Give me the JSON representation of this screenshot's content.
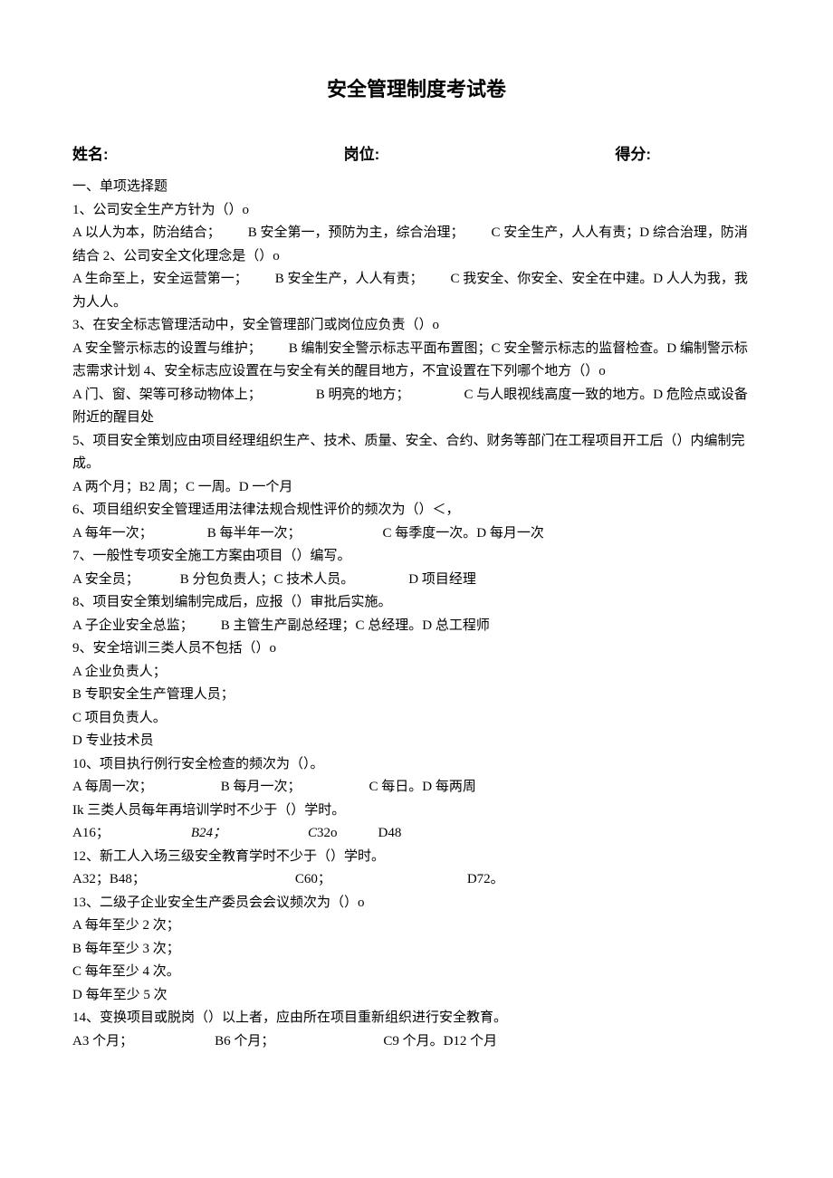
{
  "title": "安全管理制度考试卷",
  "header": {
    "name_label": "姓名:",
    "post_label": "岗位:",
    "score_label": "得分:"
  },
  "section1_heading": "一、单项选择题",
  "lines": {
    "q1": "1、公司安全生产方针为（）o",
    "q1o": "A 以人为本，防治结合；  B 安全第一，预防为主，综合治理；  C 安全生产，人人有责；D 综合治理，防消结合 2、公司安全文化理念是（）o",
    "q2o": "A 生命至上，安全运营第一；  B 安全生产，人人有责；  C 我安全、你安全、安全在中建。D 人人为我，我为人人。",
    "q3": "3、在安全标志管理活动中，安全管理部门或岗位应负责（）o",
    "q3o": "A 安全警示标志的设置与维护；  B 编制安全警示标志平面布置图；C 安全警示标志的监督检查。D 编制警示标志需求计划 4、安全标志应设置在与安全有关的醒目地方，不宜设置在下列哪个地方（）o",
    "q4o": "A 门、窗、架等可移动物体上；    B 明亮的地方；    C 与人眼视线高度一致的地方。D 危险点或设备附近的醒目处",
    "q5": "5、项目安全策划应由项目经理组织生产、技术、质量、安全、合约、财务等部门在工程项目开工后（）内编制完成。",
    "q5o": "A 两个月；B2 周；C 一周。D 一个月",
    "q6": "6、项目组织安全管理适用法律法规合规性评价的频次为（）＜，",
    "q6o": "A 每年一次；    B 每半年一次；      C 每季度一次。D 每月一次",
    "q7": "7、一般性专项安全施工方案由项目（）编写。",
    "q7o": "A 安全员；   B 分包负责人；C 技术人员。    D 项目经理",
    "q8": "8、项目安全策划编制完成后，应报（）审批后实施。",
    "q8o": "A 子企业安全总监；  B 主管生产副总经理；C 总经理。D 总工程师",
    "q9": "9、安全培训三类人员不包括（）o",
    "q9a": "A 企业负责人；",
    "q9b": "B 专职安全生产管理人员；",
    "q9c": "C 项目负责人。",
    "q9d": "D 专业技术员",
    "q10": "10、项目执行例行安全检查的频次为（）。",
    "q10o": "A 每周一次；     B 每月一次；     C 每日。D 每两周",
    "q11": "Ik 三类人员每年再培训学时不少于（）学时。",
    "q11a": "A16；",
    "q11b": "B24；",
    "q11c": "C",
    "q11c2": "32o",
    "q11d": "D48",
    "q12": "12、新工人入场三级安全教育学时不少于（）学时。",
    "q12o": "A32；B48；           C60；          D72。",
    "q13": "13、二级子企业安全生产委员会会议频次为（）o",
    "q13a": "A 每年至少 2 次；",
    "q13b": "B 每年至少 3 次；",
    "q13c": "C 每年至少 4 次。",
    "q13d": "D 每年至少 5 次",
    "q14": "14、变换项目或脱岗（）以上者，应由所在项目重新组织进行安全教育。",
    "q14o": "A3 个月；      B6 个月；        C9 个月。D12 个月"
  }
}
